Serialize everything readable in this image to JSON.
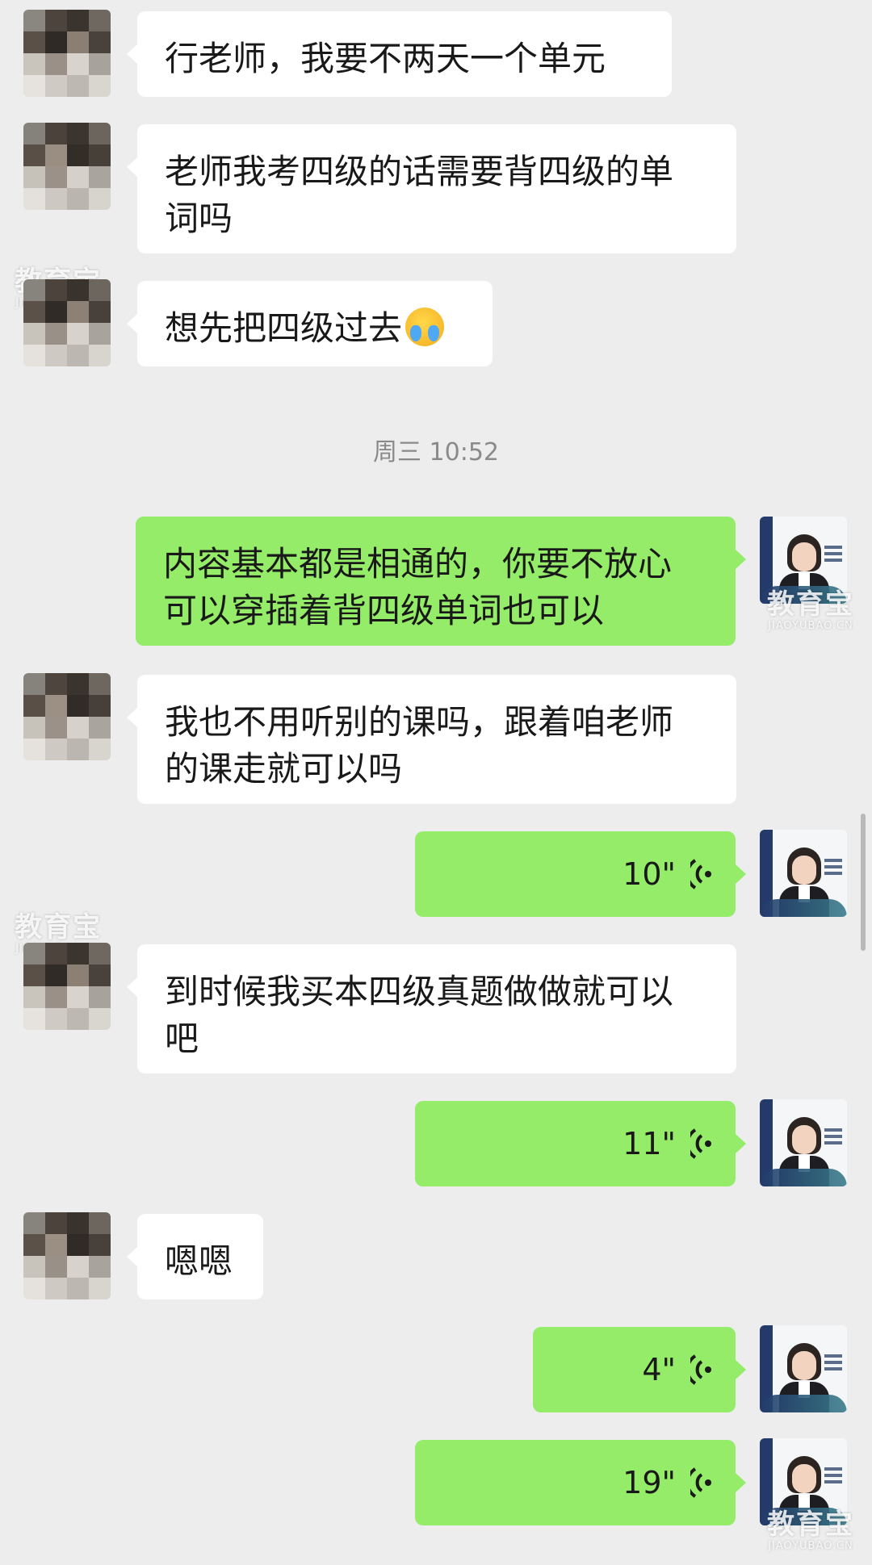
{
  "timestamp": "周三 10:52",
  "watermark": {
    "cn": "教育宝",
    "en": "JIAOYUBAO.CN"
  },
  "colors": {
    "chat_background": "#ededed",
    "own_bubble": "#95ec69",
    "peer_bubble": "#ffffff"
  },
  "messages": [
    {
      "side": "left",
      "type": "text",
      "lines": [
        "行老师，我要不两天一个单元"
      ]
    },
    {
      "side": "left",
      "type": "text",
      "lines": [
        "老师我考四级的话需要背四级的单",
        "词吗"
      ]
    },
    {
      "side": "left",
      "type": "text",
      "lines": [
        "想先把四级过去"
      ],
      "emoji": "crying-laughing-emoji"
    },
    {
      "side": "right",
      "type": "text",
      "lines": [
        "内容基本都是相通的，你要不放心",
        "可以穿插着背四级单词也可以"
      ]
    },
    {
      "side": "left",
      "type": "text",
      "lines": [
        "我也不用听别的课吗，跟着咱老师",
        "的课走就可以吗"
      ]
    },
    {
      "side": "right",
      "type": "voice",
      "duration": "10\""
    },
    {
      "side": "left",
      "type": "text",
      "lines": [
        "到时候我买本四级真题做做就可以",
        "吧"
      ]
    },
    {
      "side": "right",
      "type": "voice",
      "duration": "11\""
    },
    {
      "side": "left",
      "type": "text",
      "lines": [
        "嗯嗯"
      ]
    },
    {
      "side": "right",
      "type": "voice",
      "duration": "4\""
    },
    {
      "side": "right",
      "type": "voice",
      "duration": "19\""
    }
  ]
}
